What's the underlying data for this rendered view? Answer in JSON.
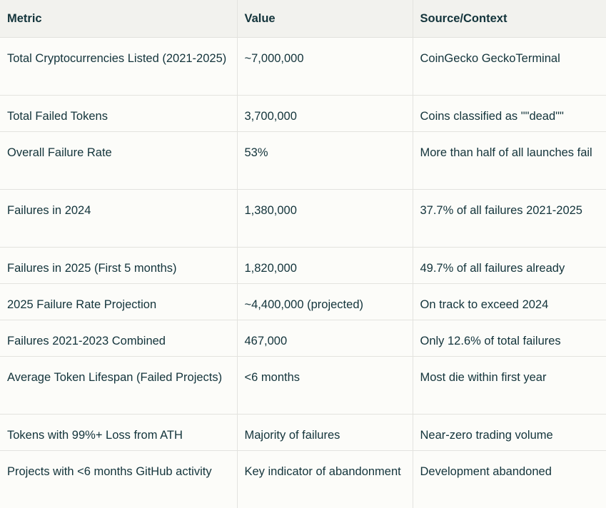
{
  "table": {
    "headers": [
      "Metric",
      "Value",
      "Source/Context"
    ],
    "rows": [
      [
        "Total Cryptocurrencies Listed (2021-2025)",
        "~7,000,000",
        "CoinGecko GeckoTerminal"
      ],
      [
        "Total Failed Tokens",
        "3,700,000",
        "Coins classified as \"\"dead\"\""
      ],
      [
        "Overall Failure Rate",
        "53%",
        "More than half of all launches fail"
      ],
      [
        "Failures in 2024",
        "1,380,000",
        "37.7% of all failures 2021-2025"
      ],
      [
        "Failures in 2025 (First 5 months)",
        "1,820,000",
        "49.7% of all failures already"
      ],
      [
        "2025 Failure Rate Projection",
        "~4,400,000 (projected)",
        "On track to exceed 2024"
      ],
      [
        "Failures 2021-2023 Combined",
        "467,000",
        "Only 12.6% of total failures"
      ],
      [
        "Average Token Lifespan (Failed Projects)",
        "<6 months",
        "Most die within first year"
      ],
      [
        "Tokens with 99%+ Loss from ATH",
        "Majority of failures",
        "Near-zero trading volume"
      ],
      [
        "Projects with <6 months GitHub activity",
        "Key indicator of abandonment",
        "Development abandoned"
      ]
    ]
  }
}
